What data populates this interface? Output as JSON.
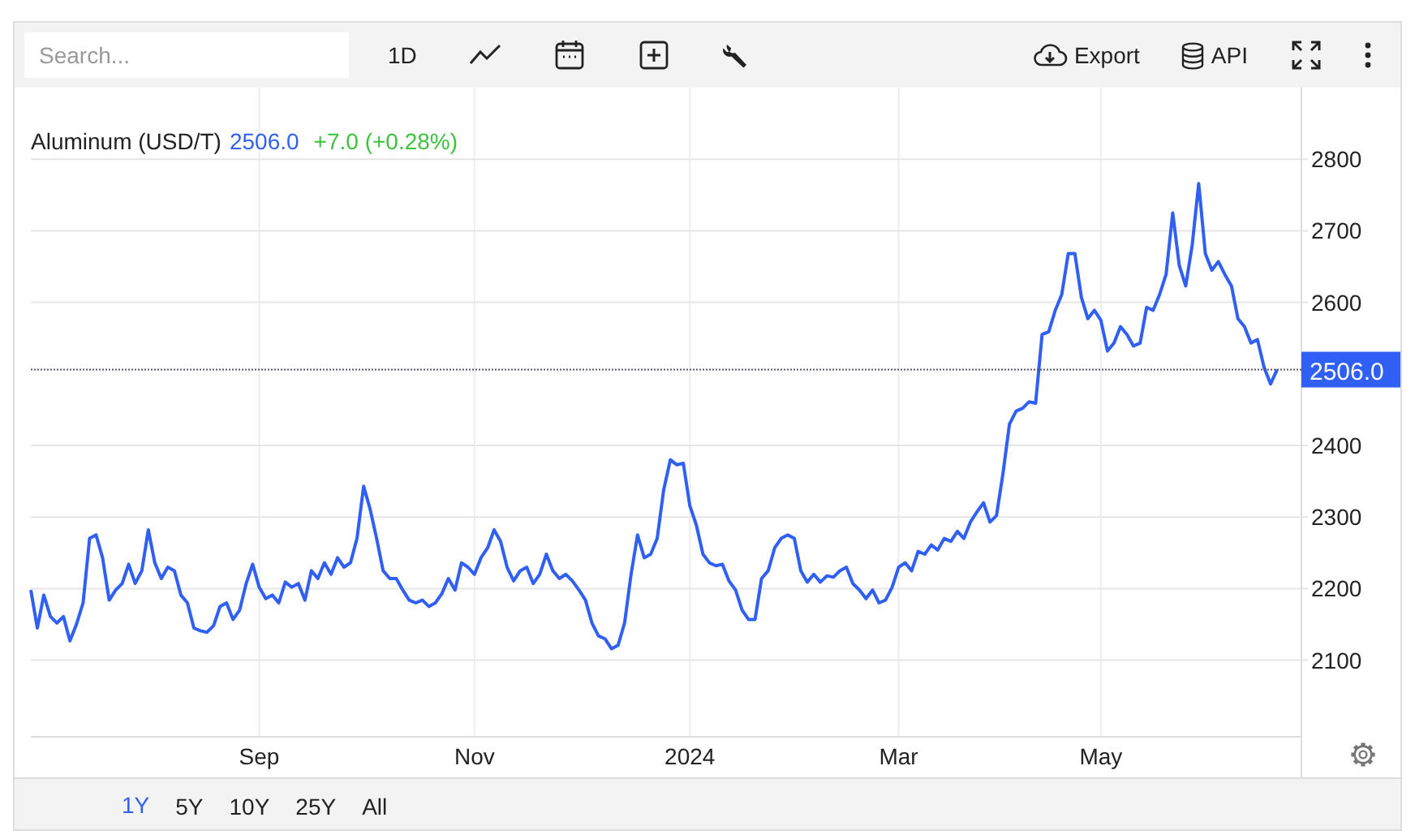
{
  "toolbar": {
    "search": {
      "placeholder": "Search..."
    },
    "interval": "1D",
    "export": "Export",
    "api": "API"
  },
  "legend": {
    "price": "2506.0",
    "change": "+7.0 (+0.28%)"
  },
  "last_price_label": "2506.0",
  "chart_data": {
    "type": "line",
    "grid": true,
    "ref_lines": [
      {
        "axis": "y",
        "value": 2506
      }
    ],
    "ylim": [
      1993,
      2900
    ],
    "categories": [
      null,
      null,
      null,
      null,
      null,
      null,
      null,
      null,
      null,
      null,
      null,
      null,
      null,
      null,
      null,
      null,
      null,
      null,
      null,
      null,
      null,
      null,
      null,
      null,
      null,
      null,
      null,
      null,
      null,
      null,
      null,
      null,
      null,
      null,
      null,
      "Sep",
      null,
      null,
      null,
      null,
      null,
      null,
      null,
      null,
      null,
      null,
      null,
      null,
      null,
      null,
      null,
      null,
      null,
      null,
      null,
      null,
      null,
      null,
      null,
      null,
      null,
      null,
      null,
      null,
      null,
      null,
      null,
      null,
      "Nov",
      null,
      null,
      null,
      null,
      null,
      null,
      null,
      null,
      null,
      null,
      null,
      null,
      null,
      null,
      null,
      null,
      null,
      null,
      null,
      null,
      null,
      null,
      null,
      null,
      null,
      null,
      null,
      null,
      null,
      null,
      null,
      null,
      "2024",
      null,
      null,
      null,
      null,
      null,
      null,
      null,
      null,
      null,
      null,
      null,
      null,
      null,
      null,
      null,
      null,
      null,
      null,
      null,
      null,
      null,
      null,
      null,
      null,
      null,
      null,
      null,
      null,
      null,
      null,
      null,
      "Mar",
      null,
      null,
      null,
      null,
      null,
      null,
      null,
      null,
      null,
      null,
      null,
      null,
      null,
      null,
      null,
      null,
      null,
      null,
      null,
      null,
      null,
      null,
      null,
      null,
      null,
      null,
      null,
      null,
      null,
      null,
      "May",
      null,
      null,
      null,
      null,
      null,
      null,
      null,
      null,
      null,
      null,
      null,
      null,
      null,
      null,
      null,
      null,
      null,
      null,
      null,
      null,
      null,
      null,
      null,
      null,
      null,
      null,
      null
    ],
    "yticks": [
      2100,
      2200,
      2300,
      2400,
      2600,
      2700,
      2800
    ],
    "series": [
      {
        "name": "Aluminum (USD/T)",
        "color": "#2f5ff5",
        "values": [
          2198,
          2145,
          2191,
          2161,
          2152,
          2161,
          2127,
          2150,
          2180,
          2270,
          2275,
          2243,
          2184,
          2198,
          2207,
          2234,
          2207,
          2225,
          2282,
          2236,
          2214,
          2230,
          2225,
          2191,
          2180,
          2145,
          2141,
          2139,
          2148,
          2175,
          2180,
          2157,
          2170,
          2207,
          2234,
          2202,
          2186,
          2191,
          2180,
          2209,
          2202,
          2207,
          2184,
          2225,
          2214,
          2236,
          2220,
          2243,
          2230,
          2236,
          2270,
          2343,
          2311,
          2270,
          2225,
          2214,
          2214,
          2198,
          2184,
          2180,
          2184,
          2175,
          2180,
          2193,
          2214,
          2198,
          2236,
          2230,
          2220,
          2243,
          2257,
          2282,
          2266,
          2230,
          2211,
          2225,
          2230,
          2207,
          2220,
          2248,
          2225,
          2214,
          2220,
          2211,
          2198,
          2184,
          2152,
          2134,
          2130,
          2116,
          2121,
          2152,
          2220,
          2275,
          2243,
          2248,
          2270,
          2338,
          2380,
          2373,
          2375,
          2316,
          2289,
          2248,
          2236,
          2232,
          2234,
          2211,
          2198,
          2170,
          2157,
          2157,
          2214,
          2225,
          2257,
          2270,
          2275,
          2270,
          2225,
          2209,
          2220,
          2209,
          2218,
          2216,
          2225,
          2230,
          2207,
          2198,
          2186,
          2198,
          2180,
          2184,
          2202,
          2230,
          2236,
          2225,
          2252,
          2248,
          2261,
          2254,
          2270,
          2266,
          2280,
          2270,
          2293,
          2307,
          2320,
          2293,
          2302,
          2361,
          2430,
          2448,
          2452,
          2461,
          2459,
          2555,
          2559,
          2589,
          2611,
          2668,
          2668,
          2607,
          2577,
          2589,
          2575,
          2532,
          2543,
          2566,
          2555,
          2539,
          2543,
          2593,
          2589,
          2611,
          2639,
          2725,
          2652,
          2623,
          2680,
          2766,
          2668,
          2645,
          2657,
          2639,
          2623,
          2577,
          2566,
          2543,
          2548,
          2509,
          2486,
          2506
        ]
      }
    ]
  },
  "ranges": [
    {
      "label": "1Y",
      "selected": true
    },
    {
      "label": "5Y",
      "selected": false
    },
    {
      "label": "10Y",
      "selected": false
    },
    {
      "label": "25Y",
      "selected": false
    },
    {
      "label": "All",
      "selected": false
    }
  ]
}
